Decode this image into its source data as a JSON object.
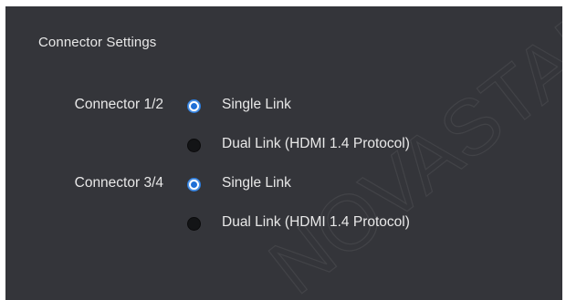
{
  "panel": {
    "title": "Connector Settings"
  },
  "groups": [
    {
      "label": "Connector 1/2",
      "options": [
        {
          "label": "Single Link",
          "selected": true
        },
        {
          "label": "Dual Link (HDMI 1.4 Protocol)",
          "selected": false
        }
      ]
    },
    {
      "label": "Connector 3/4",
      "options": [
        {
          "label": "Single Link",
          "selected": true
        },
        {
          "label": "Dual Link (HDMI 1.4 Protocol)",
          "selected": false
        }
      ]
    }
  ],
  "watermark": {
    "text": "NOVASTAR"
  },
  "colors": {
    "panel_bg": "#34353a",
    "accent": "#1f6fd6",
    "text": "#e8e8e8"
  }
}
